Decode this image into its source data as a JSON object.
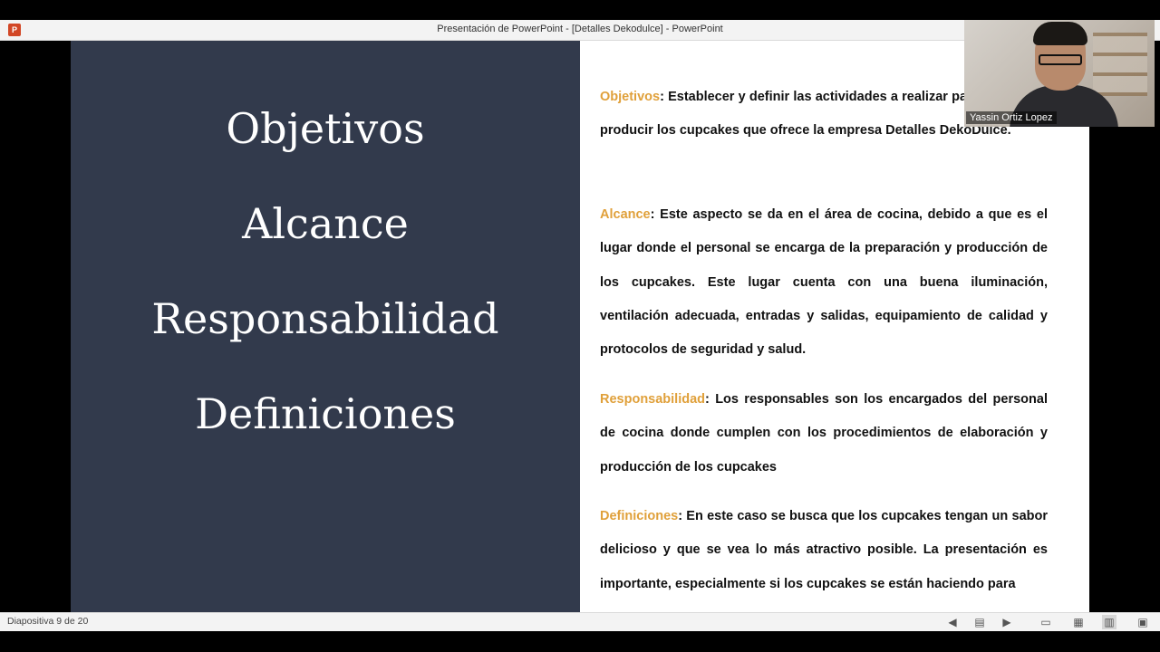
{
  "window": {
    "title": "Presentación de PowerPoint - [Detalles Dekodulce] - PowerPoint",
    "app_icon": "P"
  },
  "slide": {
    "left_topics": [
      "Objetivos",
      "Alcance",
      "Responsabilidad",
      "Definiciones"
    ],
    "paragraphs": [
      {
        "label": "Objetivos",
        "text": ": Establecer y definir las actividades a realizar para preparar y producir los cupcakes que ofrece la empresa Detalles DekoDulce."
      },
      {
        "label": "Alcance",
        "text": ": Este aspecto se da en el área de cocina, debido a que es el lugar donde el personal se encarga de la preparación y producción de los cupcakes. Este lugar cuenta con una buena iluminación, ventilación adecuada, entradas y salidas, equipamiento de calidad y protocolos de seguridad y salud."
      },
      {
        "label": "Responsabilidad",
        "text": ": Los responsables son los encargados del personal de cocina donde cumplen con los procedimientos de elaboración y producción de los cupcakes"
      },
      {
        "label": "Definiciones",
        "text": ": En este caso se busca que los cupcakes tengan un sabor delicioso y que se vea lo más atractivo posible. La presentación es importante, especialmente si los cupcakes se están haciendo para"
      }
    ]
  },
  "video": {
    "participant_name": "Yassin Ortiz Lopez"
  },
  "statusbar": {
    "slide_counter": "Diapositiva 9 de 20"
  },
  "colors": {
    "left_panel": "#323a4c",
    "label_accent": "#e0a03a"
  }
}
